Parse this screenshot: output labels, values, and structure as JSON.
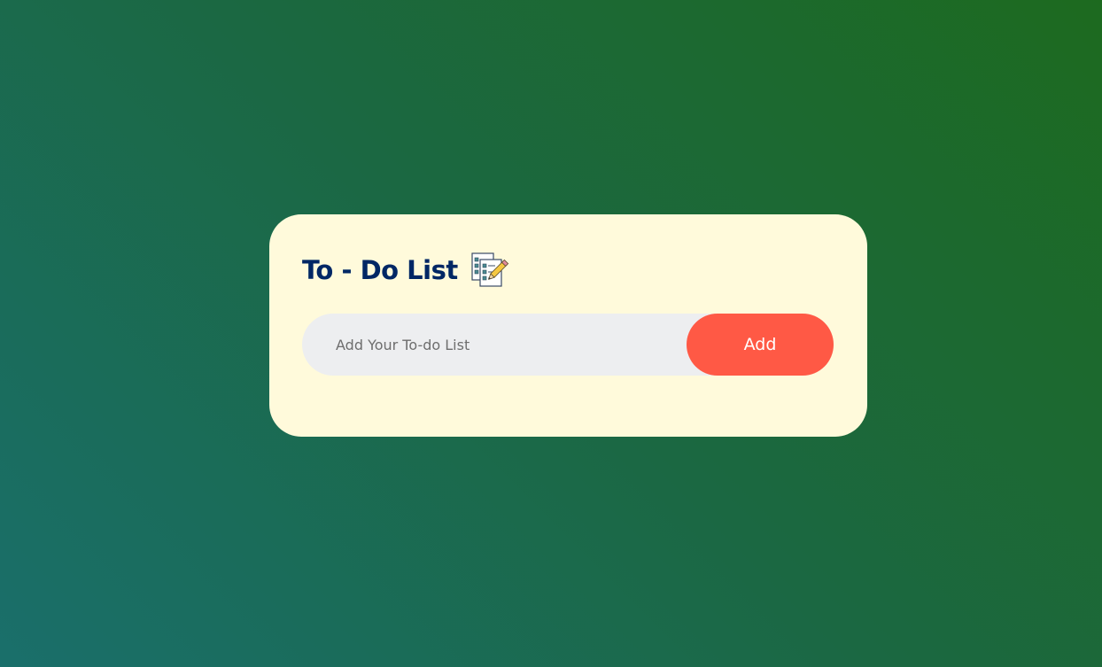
{
  "app": {
    "title": "To - Do List",
    "title_icon": "checklist-pencil-icon"
  },
  "todo_input": {
    "placeholder": "Add Your To-do List",
    "value": ""
  },
  "add_button": {
    "label": "Add"
  },
  "todo_items": [],
  "colors": {
    "title": "#002765",
    "card_background": "#fffadb",
    "input_background": "#edeef0",
    "add_button": "#ff5945",
    "gradient_start": "#1a6f6b",
    "gradient_end": "#1d6a1f"
  }
}
